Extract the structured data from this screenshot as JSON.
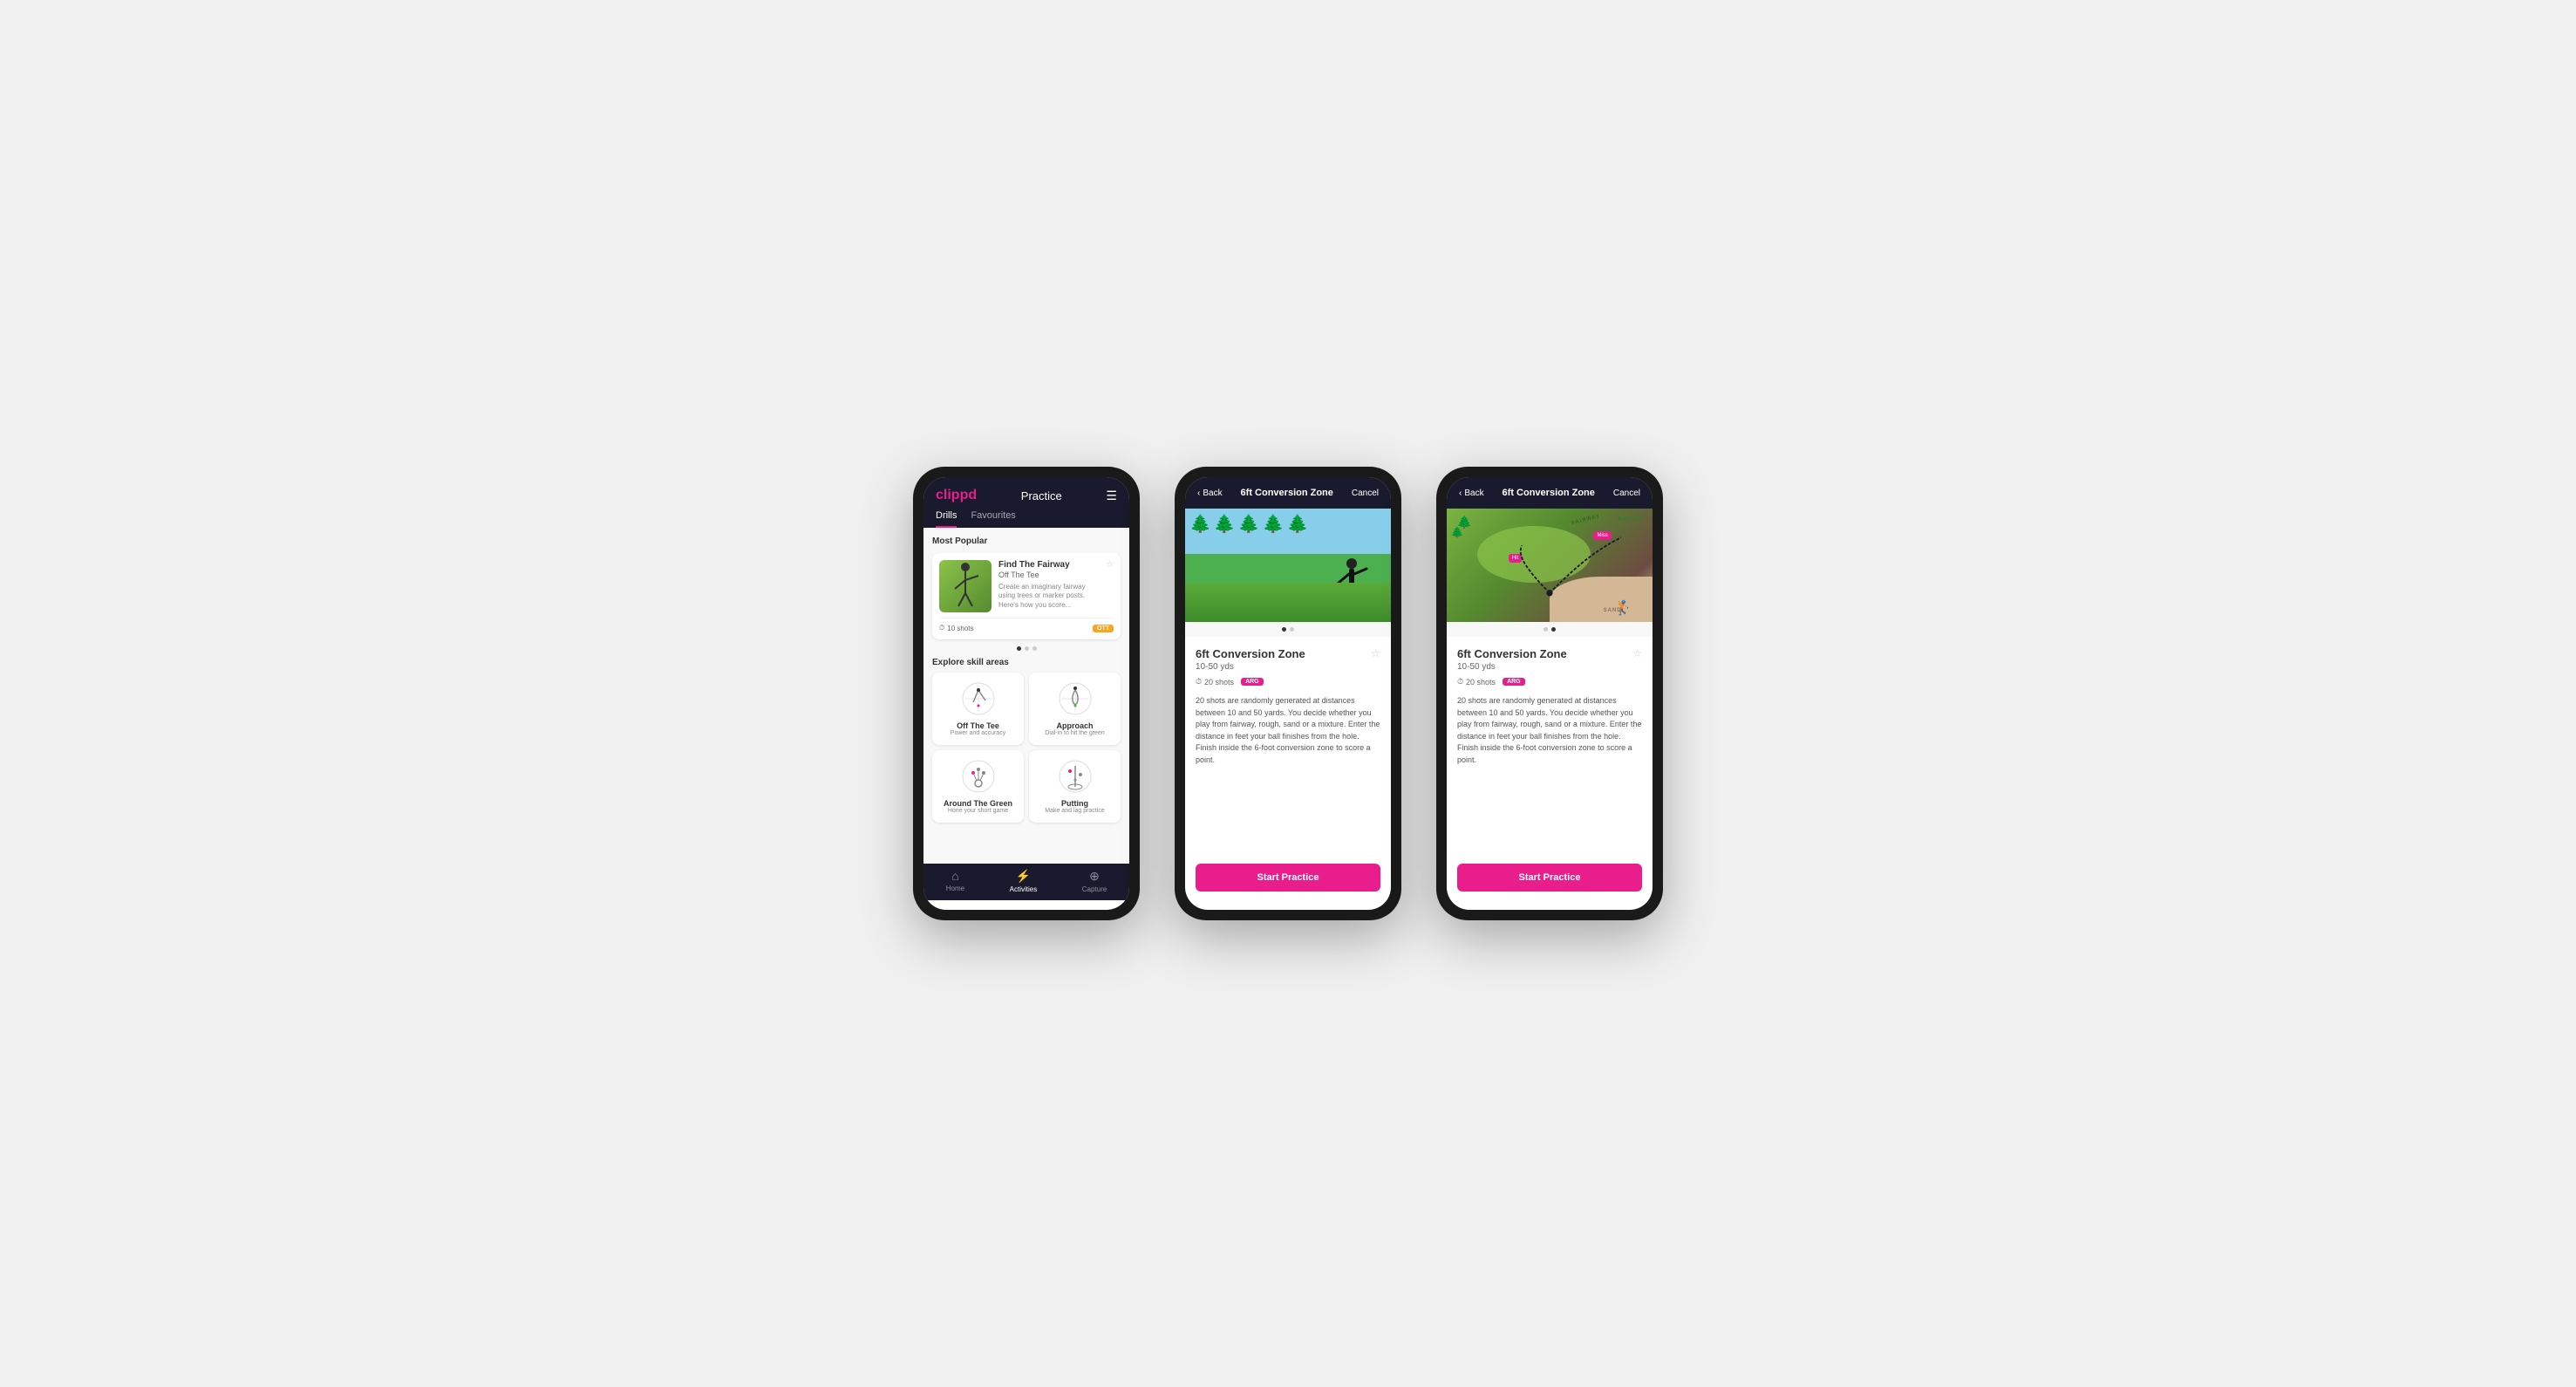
{
  "phones": {
    "phone1": {
      "header": {
        "logo": "clippd",
        "title": "Practice",
        "menu_icon": "☰"
      },
      "tabs": [
        {
          "label": "Drills",
          "active": true
        },
        {
          "label": "Favourites",
          "active": false
        }
      ],
      "most_popular": {
        "section_title": "Most Popular",
        "drill": {
          "name": "Find The Fairway",
          "category": "Off The Tee",
          "description": "Create an imaginary fairway using trees or marker posts. Here's how you score...",
          "shots": "10 shots",
          "tag": "OTT"
        }
      },
      "explore": {
        "section_title": "Explore skill areas",
        "skills": [
          {
            "name": "Off The Tee",
            "desc": "Power and accuracy"
          },
          {
            "name": "Approach",
            "desc": "Dial-in to hit the green"
          },
          {
            "name": "Around The Green",
            "desc": "Hone your short game"
          },
          {
            "name": "Putting",
            "desc": "Make and lag practice"
          }
        ]
      },
      "nav": [
        {
          "label": "Home",
          "active": false
        },
        {
          "label": "Activities",
          "active": true
        },
        {
          "label": "Capture",
          "active": false
        }
      ]
    },
    "phone2": {
      "header": {
        "back_label": "Back",
        "title": "6ft Conversion Zone",
        "cancel_label": "Cancel"
      },
      "drill": {
        "name": "6ft Conversion Zone",
        "range": "10-50 yds",
        "shots": "20 shots",
        "tag": "ARG",
        "description": "20 shots are randomly generated at distances between 10 and 50 yards. You decide whether you play from fairway, rough, sand or a mixture. Enter the distance in feet your ball finishes from the hole. Finish inside the 6-foot conversion zone to score a point.",
        "start_label": "Start Practice"
      },
      "image_type": "photo"
    },
    "phone3": {
      "header": {
        "back_label": "Back",
        "title": "6ft Conversion Zone",
        "cancel_label": "Cancel"
      },
      "drill": {
        "name": "6ft Conversion Zone",
        "range": "10-50 yds",
        "shots": "20 shots",
        "tag": "ARG",
        "description": "20 shots are randomly generated at distances between 10 and 50 yards. You decide whether you play from fairway, rough, sand or a mixture. Enter the distance in feet your ball finishes from the hole. Finish inside the 6-foot conversion zone to score a point.",
        "start_label": "Start Practice"
      },
      "image_type": "map"
    }
  }
}
